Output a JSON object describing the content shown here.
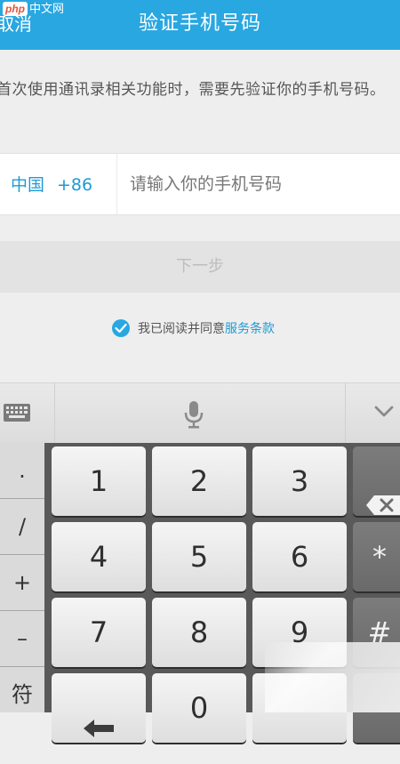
{
  "watermark": {
    "badge": "php",
    "text": "中文网"
  },
  "header": {
    "cancel_label": "取消",
    "title": "验证手机号码",
    "bg_color": "#29a7e1"
  },
  "notice": {
    "text": "首次使用通讯录相关功能时，需要先验证你的手机号码。"
  },
  "phone": {
    "country": "中国",
    "code": "+86",
    "placeholder": "请输入你的手机号码",
    "value": ""
  },
  "next_button": {
    "label": "下一步"
  },
  "agreement": {
    "checked": true,
    "text": "我已阅读并同意",
    "link_label": "服务条款"
  },
  "toolbar": {
    "icons": [
      "keyboard-icon",
      "microphone-icon",
      "chevron-down-icon"
    ]
  },
  "keyboard": {
    "symbols": [
      ".",
      "/",
      "+",
      "–",
      "符"
    ],
    "rows": [
      [
        "1",
        "2",
        "3"
      ],
      [
        "4",
        "5",
        "6"
      ],
      [
        "7",
        "8",
        "9"
      ],
      [
        "",
        "0",
        ""
      ]
    ],
    "side": [
      "",
      "*",
      "#",
      ""
    ]
  }
}
